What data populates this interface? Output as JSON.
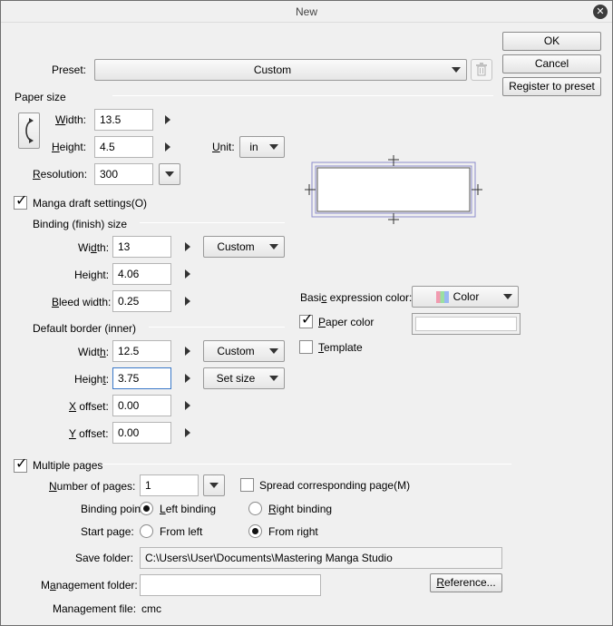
{
  "window": {
    "title": "New"
  },
  "buttons": {
    "ok": "OK",
    "cancel": "Cancel",
    "register": "Register to preset",
    "reference": "Reference..."
  },
  "preset": {
    "label": "Preset:",
    "value": "Custom"
  },
  "paper_size": {
    "section": "Paper size",
    "width_label": "Width:",
    "width": "13.5",
    "height_label": "Height:",
    "height": "4.5",
    "unit_label": "Unit:",
    "unit": "in",
    "resolution_label": "Resolution:",
    "resolution": "300"
  },
  "manga": {
    "checkbox_label": "Manga draft settings(O)",
    "checked": true,
    "binding_section": "Binding (finish) size",
    "width_label": "Width:",
    "width": "13",
    "width_preset": "Custom",
    "height_label": "Height:",
    "height": "4.06",
    "bleed_label": "Bleed width:",
    "bleed": "0.25",
    "border_section": "Default border (inner)",
    "border_width_label": "Width:",
    "border_width": "12.5",
    "border_width_preset": "Custom",
    "border_height_label": "Height:",
    "border_height": "3.75",
    "border_height_preset": "Set size",
    "xoffset_label": "X offset:",
    "xoffset": "0.00",
    "yoffset_label": "Y offset:",
    "yoffset": "0.00"
  },
  "expression": {
    "label": "Basic expression color:",
    "value": "Color",
    "paper_color_label": "Paper color",
    "paper_color_checked": true,
    "paper_color": "#ffffff",
    "template_label": "Template",
    "template_checked": false
  },
  "pages": {
    "checkbox_label": "Multiple pages",
    "checked": true,
    "count_label": "Number of pages:",
    "count": "1",
    "spread_label": "Spread corresponding page(M)",
    "spread_checked": false,
    "binding_point_label": "Binding point:",
    "left_binding": "Left binding",
    "right_binding": "Right binding",
    "binding_selected": "left",
    "start_page_label": "Start page:",
    "from_left": "From left",
    "from_right": "From right",
    "start_selected": "right",
    "save_folder_label": "Save folder:",
    "save_folder": "C:\\Users\\User\\Documents\\Mastering Manga Studio",
    "management_folder_label": "Management folder:",
    "management_folder": "",
    "management_file_label": "Management file:",
    "management_file": "cmc"
  }
}
